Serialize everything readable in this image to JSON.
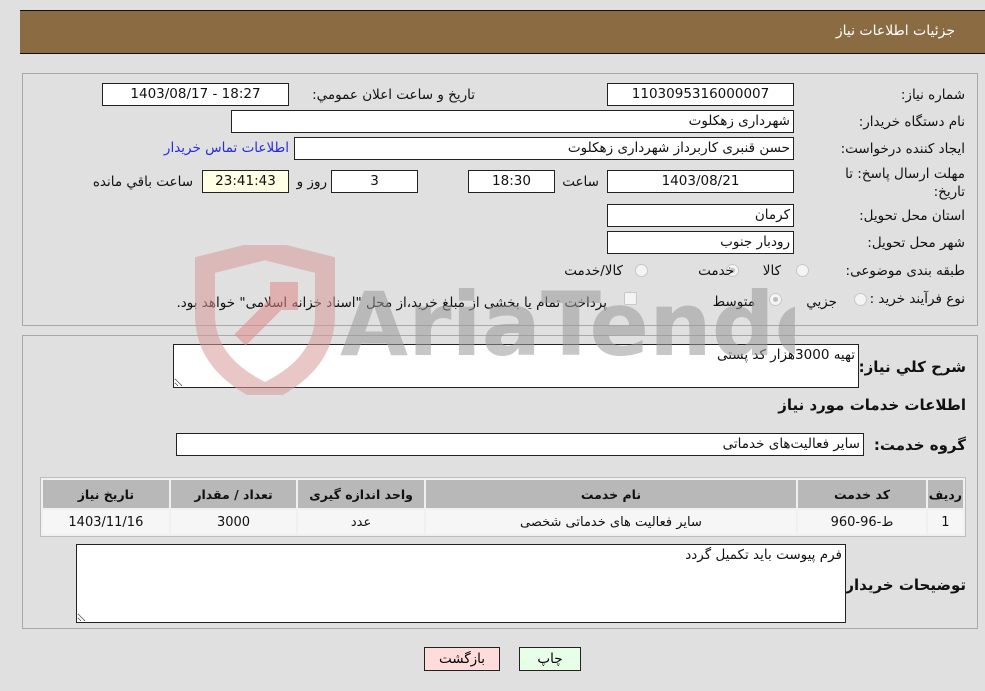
{
  "header": {
    "title": "جزئیات اطلاعات نیاز"
  },
  "details": {
    "need_number": {
      "label": "شماره نیاز:",
      "value": "1103095316000007"
    },
    "announce_datetime": {
      "label": "تاریخ و ساعت اعلان عمومي:",
      "value": "1403/08/17 - 18:27"
    },
    "buyer_org": {
      "label": "نام دستگاه خریدار:",
      "value": "شهرداری زهکلوت"
    },
    "requester": {
      "label": "ایجاد کننده درخواست:",
      "value": "حسن قنبری کاربرداز شهرداری زهکلوت"
    },
    "buyer_contact_link": "اطلاعات تماس خریدار",
    "deadline": {
      "label": "مهلت ارسال پاسخ: تا تاریخ:",
      "date": "1403/08/21",
      "time_label": "ساعت",
      "time": "18:30",
      "days": "3",
      "days_label": "روز و",
      "remaining": "23:41:43",
      "remaining_label": "ساعت باقي مانده"
    },
    "province": {
      "label": "استان محل تحویل:",
      "value": "کرمان"
    },
    "city": {
      "label": "شهر محل تحویل:",
      "value": "رودبار جنوب"
    },
    "category": {
      "label": "طبقه بندی موضوعی:",
      "options": [
        {
          "label": "کالا",
          "selected": false
        },
        {
          "label": "خدمت",
          "selected": true
        },
        {
          "label": "کالا/خدمت",
          "selected": false
        }
      ]
    },
    "purchase_process": {
      "label": "نوع فرآیند خرید :",
      "options": [
        {
          "label": "جزيي",
          "selected": false
        },
        {
          "label": "متوسط",
          "selected": true
        }
      ],
      "treasury_checkbox": {
        "label": "پرداخت تمام یا بخشی از مبلغ خرید،از محل \"اسناد خزانه اسلامی\" خواهد بود.",
        "checked": false
      }
    }
  },
  "description": {
    "label": "شرح کلي نیاز:",
    "value": "تهیه 3000هزار کد پستی"
  },
  "services_section_title": "اطلاعات خدمات مورد نیاز",
  "service_group": {
    "label": "گروه خدمت:",
    "value": "سایر فعالیت‌های خدماتی"
  },
  "services_table": {
    "columns": [
      "ردیف",
      "کد خدمت",
      "نام خدمت",
      "واحد اندازه گیری",
      "تعداد / مقدار",
      "تاریخ نیاز"
    ],
    "rows": [
      [
        "1",
        "ط-96-960",
        "سایر فعالیت های خدماتی شخصی",
        "عدد",
        "3000",
        "1403/11/16"
      ]
    ]
  },
  "buyer_notes": {
    "label": "توضیحات خریدار:",
    "value": "فرم پیوست باید تکمیل گردد"
  },
  "buttons": {
    "print": "چاپ",
    "back": "بازگشت"
  },
  "watermark": {
    "text": "AriaTender.neT"
  }
}
